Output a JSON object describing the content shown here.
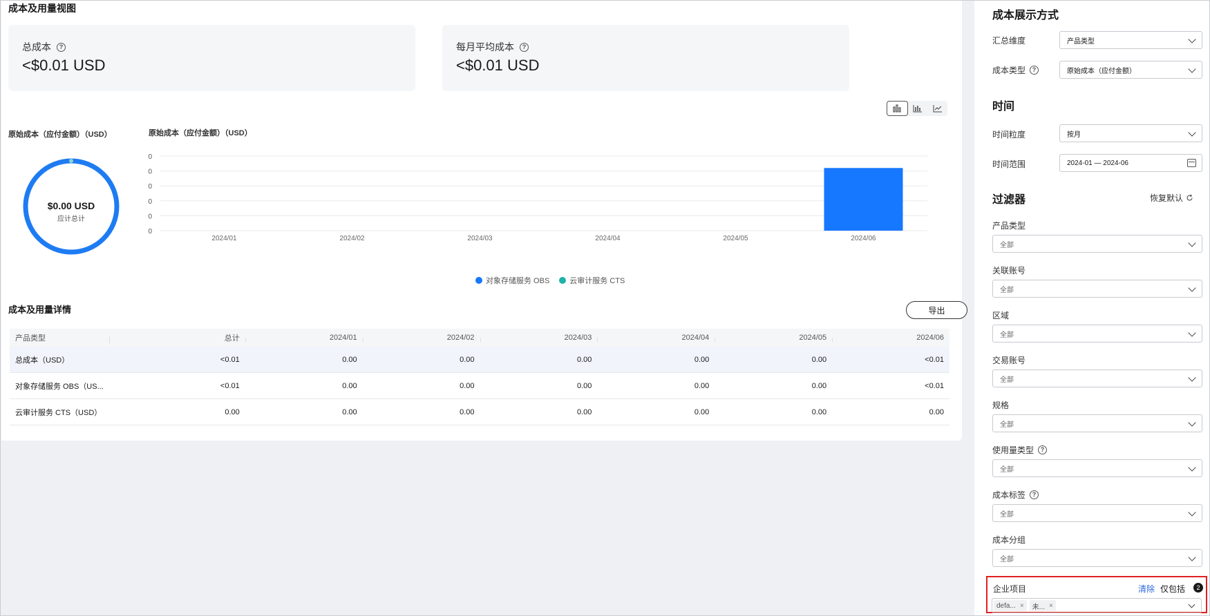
{
  "main": {
    "title": "成本及用量视图",
    "cards": [
      {
        "label": "总成本",
        "value": "<$0.01 USD"
      },
      {
        "label": "每月平均成本",
        "value": "<$0.01 USD"
      }
    ],
    "view_modes": [
      "bar-chart-icon",
      "stacked-bar-icon",
      "line-chart-icon"
    ],
    "donut": {
      "title": "原始成本（应付金额）（USD）",
      "amount": "$0.00 USD",
      "sub": "应计总计",
      "ring_color": "#1e7cf2"
    }
  },
  "chart_data": {
    "type": "bar",
    "title": "原始成本（应付金额）（USD）",
    "categories": [
      "2024/01",
      "2024/02",
      "2024/03",
      "2024/04",
      "2024/05",
      "2024/06"
    ],
    "y_tick_labels": [
      "0",
      "0",
      "0",
      "0",
      "0",
      "0"
    ],
    "series": [
      {
        "name": "对象存储服务 OBS",
        "color": "#1677ff",
        "values": [
          0,
          0,
          0,
          0,
          0,
          0.0042
        ]
      },
      {
        "name": "云审计服务 CTS",
        "color": "#20b2aa",
        "values": [
          0,
          0,
          0,
          0,
          0,
          0
        ]
      }
    ],
    "ylim": [
      0,
      0.005
    ],
    "grid": true,
    "legend": "bottom"
  },
  "details": {
    "title": "成本及用量详情",
    "export_label": "导出",
    "columns": [
      "产品类型",
      "总计",
      "2024/01",
      "2024/02",
      "2024/03",
      "2024/04",
      "2024/05",
      "2024/06"
    ],
    "rows": [
      [
        "总成本（USD）",
        "<0.01",
        "0.00",
        "0.00",
        "0.00",
        "0.00",
        "0.00",
        "<0.01"
      ],
      [
        "对象存储服务 OBS（US...",
        "<0.01",
        "0.00",
        "0.00",
        "0.00",
        "0.00",
        "0.00",
        "<0.01"
      ],
      [
        "云审计服务 CTS（USD）",
        "0.00",
        "0.00",
        "0.00",
        "0.00",
        "0.00",
        "0.00",
        "0.00"
      ]
    ]
  },
  "side": {
    "display_title": "成本展示方式",
    "group_by": {
      "label": "汇总维度",
      "value": "产品类型"
    },
    "cost_type": {
      "label": "成本类型",
      "value": "原始成本（应付金额）"
    },
    "time_title": "时间",
    "granularity": {
      "label": "时间粒度",
      "value": "按月"
    },
    "range": {
      "label": "时间范围",
      "value": "2024-01 — 2024-06"
    },
    "filter_title": "过滤器",
    "reset_label": "恢复默认",
    "filters": [
      {
        "label": "产品类型",
        "value": "全部",
        "help": false
      },
      {
        "label": "关联账号",
        "value": "全部",
        "help": false
      },
      {
        "label": "区域",
        "value": "全部",
        "help": false
      },
      {
        "label": "交易账号",
        "value": "全部",
        "help": false
      },
      {
        "label": "规格",
        "value": "全部",
        "help": false
      },
      {
        "label": "使用量类型",
        "value": "全部",
        "help": true
      },
      {
        "label": "成本标签",
        "value": "全部",
        "help": true
      },
      {
        "label": "成本分组",
        "value": "全部",
        "help": false
      }
    ],
    "project": {
      "label": "企业项目",
      "clear": "清除",
      "only": "仅包括",
      "count": "2",
      "tags": [
        "defa...",
        "未..."
      ]
    }
  }
}
